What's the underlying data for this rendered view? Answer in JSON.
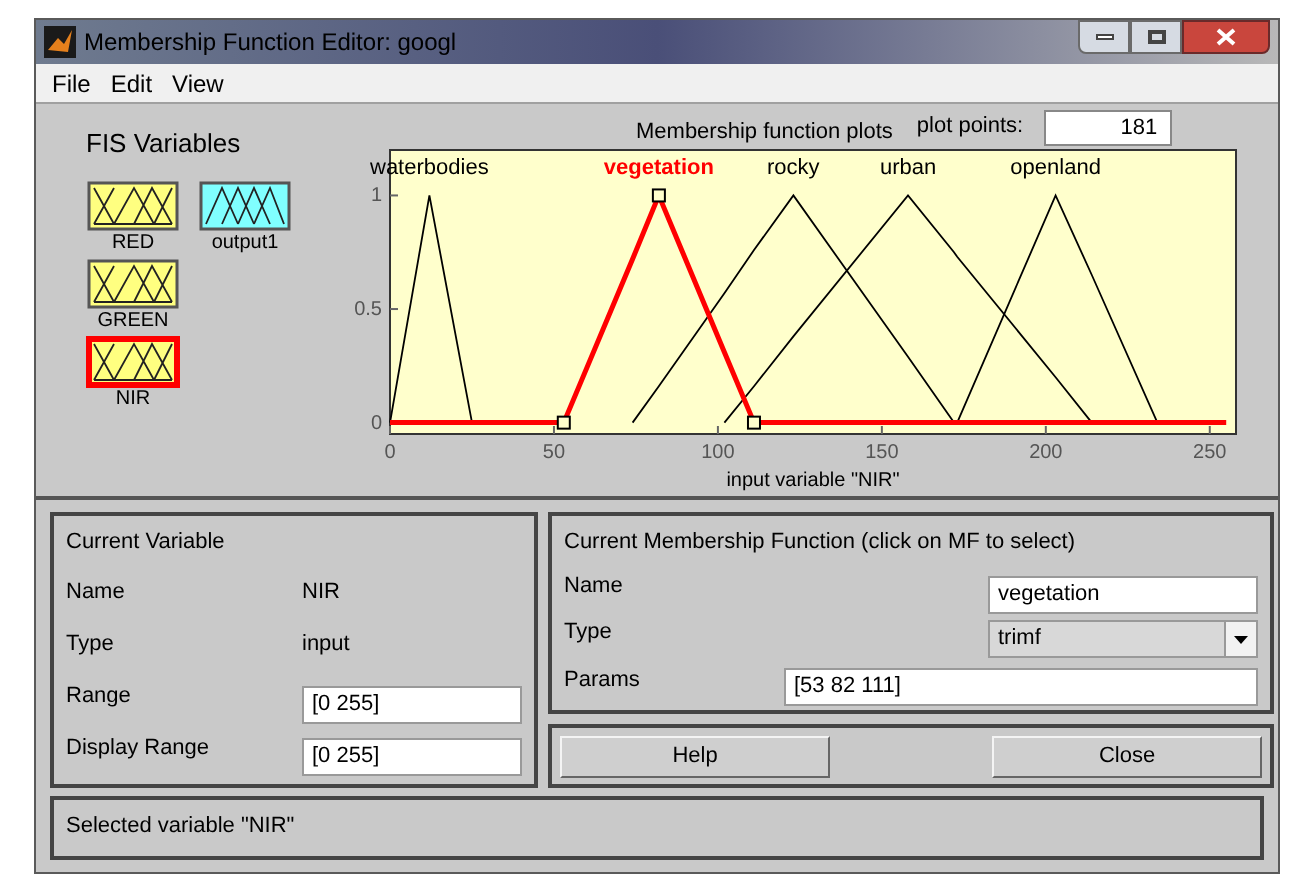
{
  "window": {
    "title": "Membership Function Editor: googl"
  },
  "menu": [
    "File",
    "Edit",
    "View"
  ],
  "fis_variables": {
    "title": "FIS Variables",
    "items": [
      {
        "label": "RED",
        "kind": "input",
        "selected": false
      },
      {
        "label": "output1",
        "kind": "output",
        "selected": false
      },
      {
        "label": "GREEN",
        "kind": "input",
        "selected": false
      },
      {
        "label": "NIR",
        "kind": "input",
        "selected": true
      }
    ]
  },
  "plot": {
    "title": "Membership function plots",
    "plot_points_label": "plot points:",
    "plot_points": "181",
    "curve_states": [
      {
        "selected": false
      },
      {
        "selected": true
      },
      {
        "selected": false
      },
      {
        "selected": false
      },
      {
        "selected": false
      }
    ],
    "chart_data": {
      "type": "line",
      "xlabel": "input variable \"NIR\"",
      "xlim": [
        0,
        258
      ],
      "ylim": [
        -0.05,
        1.2
      ],
      "xticks": [
        0,
        50,
        100,
        150,
        200,
        250
      ],
      "yticks": [
        0,
        0.5,
        1
      ],
      "x": [
        0,
        12,
        25,
        53,
        74,
        82,
        102,
        111,
        123,
        158,
        172,
        173,
        203,
        214,
        234,
        255
      ],
      "series": [
        {
          "name": "waterbodies",
          "color": "#000000",
          "values": [
            0,
            1,
            0,
            null,
            null,
            null,
            null,
            null,
            null,
            null,
            null,
            null,
            null,
            null,
            null,
            null
          ]
        },
        {
          "name": "vegetation",
          "color": "#ff0000",
          "values": [
            0,
            0,
            0,
            0,
            0.72,
            1,
            0.31,
            0,
            0,
            0,
            0,
            0,
            0,
            0,
            0,
            0
          ]
        },
        {
          "name": "rocky",
          "color": "#000000",
          "values": [
            null,
            null,
            null,
            null,
            0,
            0.16,
            0.57,
            0.76,
            1,
            0.29,
            0,
            null,
            null,
            null,
            null,
            null
          ]
        },
        {
          "name": "urban",
          "color": "#000000",
          "values": [
            null,
            null,
            null,
            null,
            null,
            null,
            0,
            0.16,
            0.38,
            1,
            0.75,
            0.73,
            0.2,
            0,
            null,
            null
          ]
        },
        {
          "name": "openland",
          "color": "#000000",
          "values": [
            null,
            null,
            null,
            null,
            null,
            null,
            null,
            null,
            null,
            null,
            null,
            0,
            1,
            0.65,
            0,
            null
          ]
        }
      ]
    }
  },
  "current_variable": {
    "title": "Current Variable",
    "fields": [
      {
        "label": "Name",
        "value": "NIR",
        "kind": "text"
      },
      {
        "label": "Type",
        "value": "input",
        "kind": "text"
      },
      {
        "label": "Range",
        "value": "[0 255]",
        "kind": "field"
      },
      {
        "label": "Display Range",
        "value": "[0 255]",
        "kind": "field"
      }
    ]
  },
  "current_mf": {
    "title": "Current Membership Function (click on MF to select)",
    "name_label": "Name",
    "name": "vegetation",
    "type_label": "Type",
    "type": "trimf",
    "params_label": "Params",
    "params": "[53 82 111]"
  },
  "buttons": [
    "Help",
    "Close"
  ],
  "status": "Selected variable \"NIR\""
}
